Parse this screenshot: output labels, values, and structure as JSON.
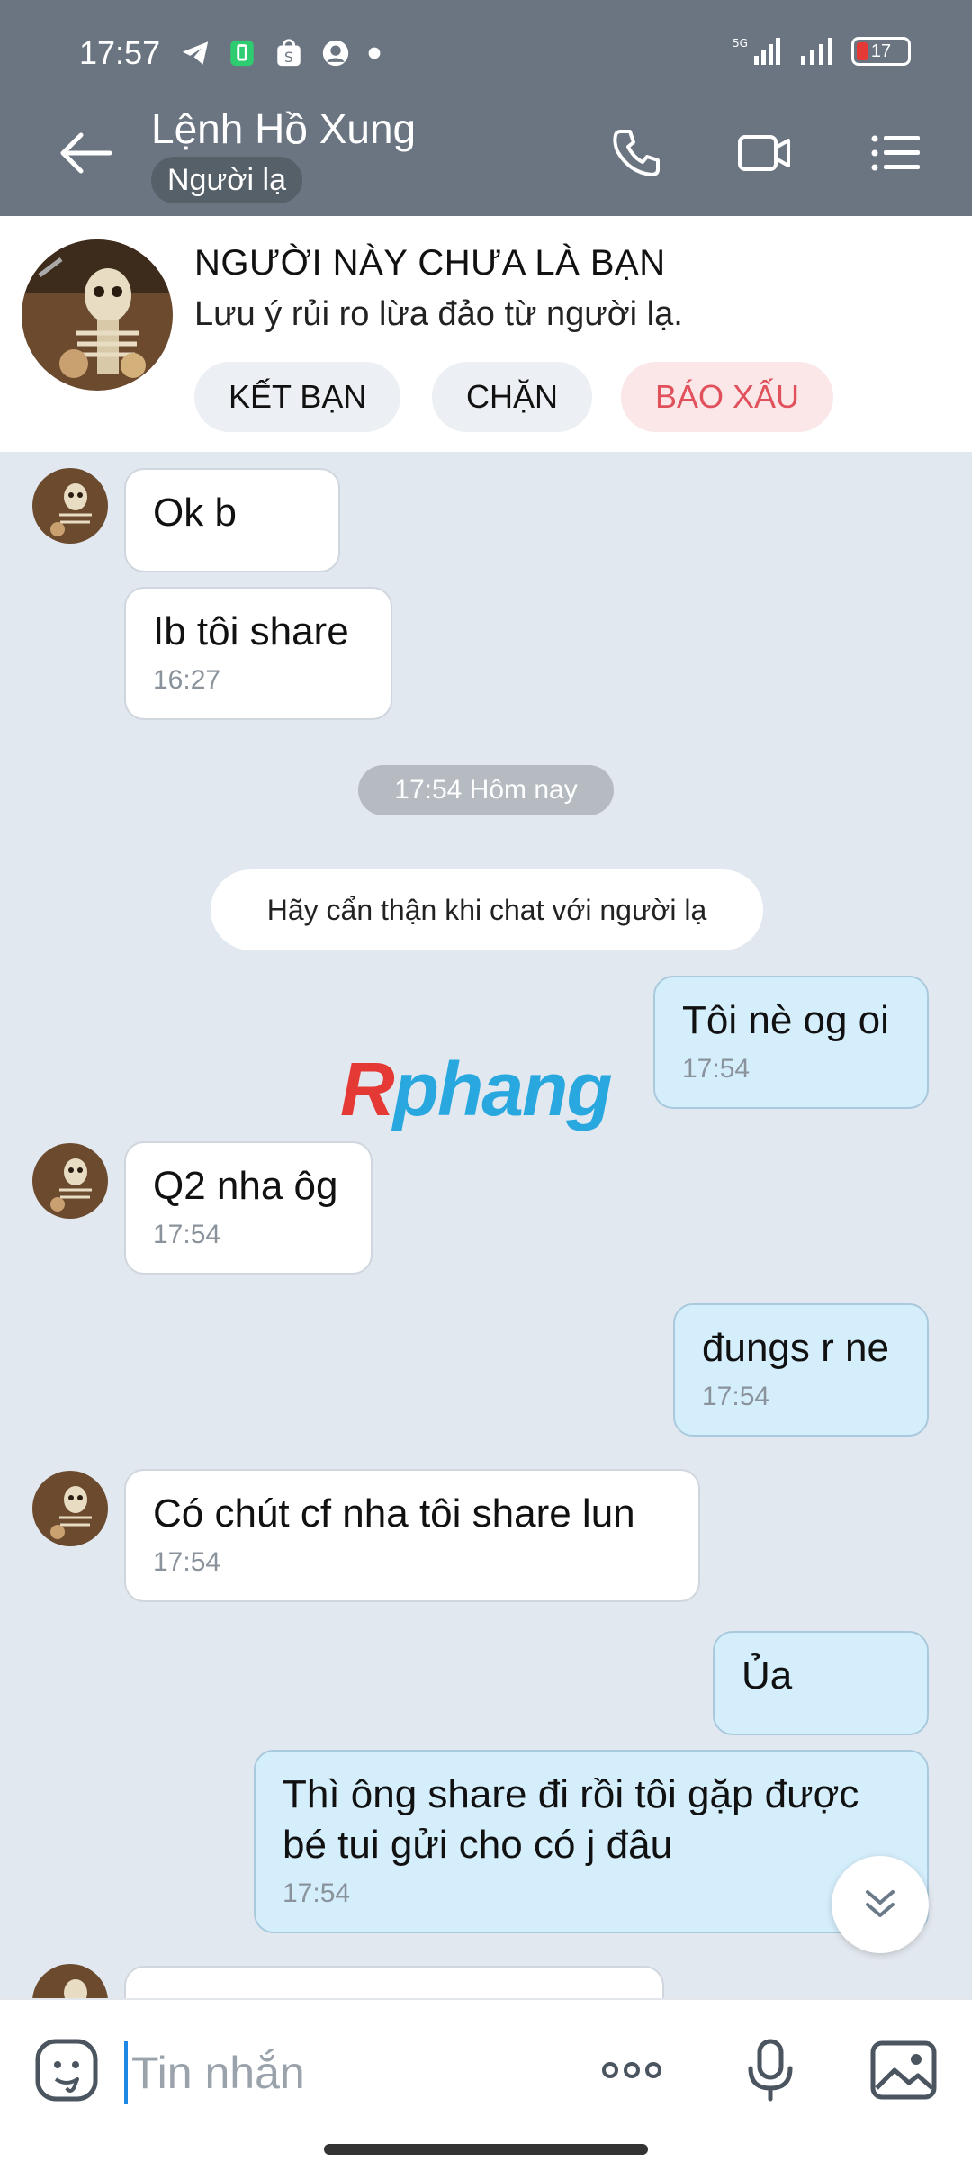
{
  "status_bar": {
    "time": "17:57",
    "network": "5G",
    "battery": "17"
  },
  "header": {
    "name": "Lệnh Hồ Xung",
    "badge": "Người lạ"
  },
  "stranger_panel": {
    "title": "NGƯỜI NÀY CHƯA LÀ BẠN",
    "subtitle": "Lưu ý rủi ro lừa đảo từ người lạ.",
    "add_friend": "KẾT BẠN",
    "block": "CHẶN",
    "report": "BÁO XẤU"
  },
  "chat": {
    "date_label": "17:54 Hôm nay",
    "notice": "Hãy cẩn thận khi chat với người lạ",
    "watermark_r": "R",
    "watermark_rest": "phang",
    "messages": [
      {
        "text": "Ok b"
      },
      {
        "text": "Ib tôi share",
        "time": "16:27"
      },
      {
        "text": "Tôi nè og oi",
        "time": "17:54"
      },
      {
        "text": "Q2 nha ôg",
        "time": "17:54"
      },
      {
        "text": "đungs r ne",
        "time": "17:54"
      },
      {
        "text": "Có chút cf nha tôi share lun",
        "time": "17:54"
      },
      {
        "text": "Ủa"
      },
      {
        "text": "Thì ông share đi rồi tôi gặp được bé tui gửi cho có j đâu",
        "time": "17:54"
      }
    ]
  },
  "input": {
    "placeholder": "Tin nhắn"
  },
  "colors": {
    "header": "#6b7581",
    "chat_bg": "#e2e8ef",
    "my_bubble": "#d5eefc",
    "danger": "#e0515c"
  }
}
